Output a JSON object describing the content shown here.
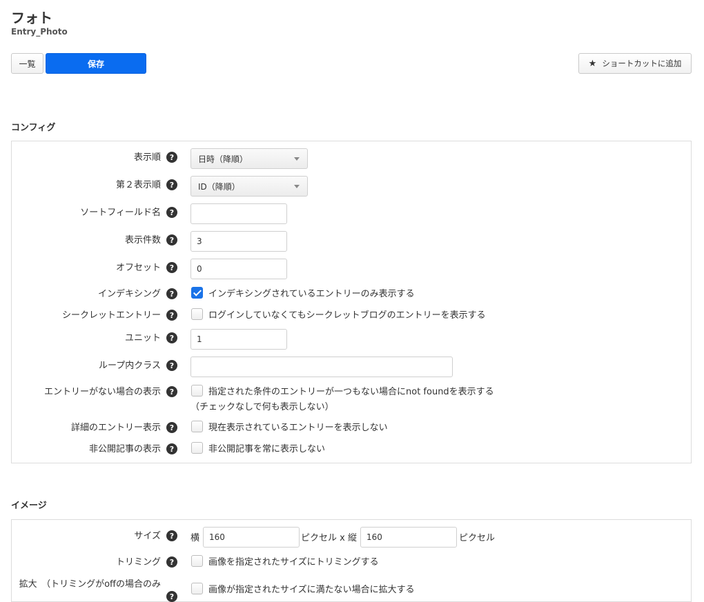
{
  "header": {
    "title": "フォト",
    "subtitle": "Entry_Photo"
  },
  "toolbar": {
    "list_label": "一覧",
    "save_label": "保存",
    "shortcut_label": "ショートカットに追加",
    "shortcut_icon": "star-icon"
  },
  "help_glyph": "?",
  "config": {
    "title": "コンフィグ",
    "order": {
      "label": "表示順",
      "value": "日時（降順）"
    },
    "order2": {
      "label": "第２表示順",
      "value": "ID（降順）"
    },
    "sort_field": {
      "label": "ソートフィールド名",
      "value": ""
    },
    "limit": {
      "label": "表示件数",
      "value": "3"
    },
    "offset": {
      "label": "オフセット",
      "value": "0"
    },
    "indexing": {
      "label": "インデキシング",
      "checked": true,
      "check_label": "インデキシングされているエントリーのみ表示する"
    },
    "secret": {
      "label": "シークレットエントリー",
      "checked": false,
      "check_label": "ログインしていなくてもシークレットブログのエントリーを表示する"
    },
    "unit": {
      "label": "ユニット",
      "value": "1"
    },
    "loop_class": {
      "label": "ループ内クラス",
      "value": ""
    },
    "notfound": {
      "label": "エントリーがない場合の表示",
      "checked": false,
      "check_label": "指定された条件のエントリーが一つもない場合にnot foundを表示する",
      "note": "（チェックなしで何も表示しない）"
    },
    "detail": {
      "label": "詳細のエントリー表示",
      "checked": false,
      "check_label": "現在表示されているエントリーを表示しない"
    },
    "private": {
      "label": "非公開記事の表示",
      "checked": false,
      "check_label": "非公開記事を常に表示しない"
    }
  },
  "image": {
    "title": "イメージ",
    "size": {
      "label": "サイズ",
      "width_prefix": "横",
      "width_value": "160",
      "middle_text": "ピクセル x 縦",
      "height_value": "160",
      "suffix": "ピクセル"
    },
    "trim": {
      "label": "トリミング",
      "checked": false,
      "check_label": "画像を指定されたサイズにトリミングする"
    },
    "zoom": {
      "label": "拡大　（トリミングがoffの場合のみ",
      "checked": false,
      "check_label": "画像が指定されたサイズに満たない場合に拡大する"
    }
  }
}
